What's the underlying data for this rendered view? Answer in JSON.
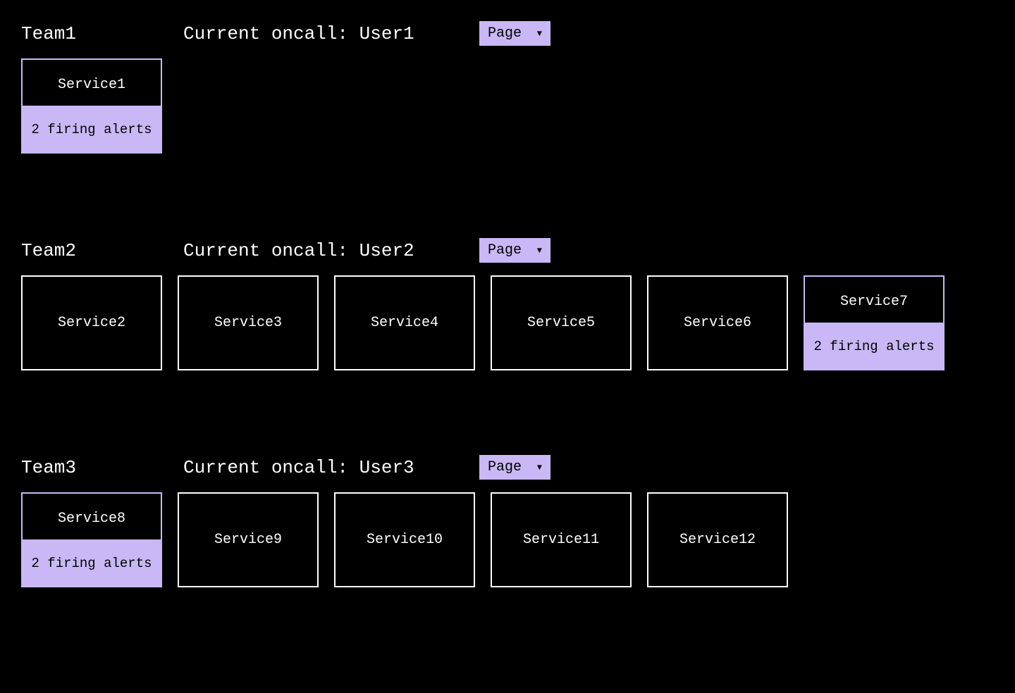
{
  "colors": {
    "accent": "#c9b8f5",
    "bg": "#000000",
    "fg": "#ffffff"
  },
  "oncall_prefix": "Current oncall: ",
  "page_action_label": "Page",
  "teams": [
    {
      "name": "Team1",
      "oncall_user": "User1",
      "services": [
        {
          "name": "Service1",
          "alert_text": "2 firing alerts"
        }
      ]
    },
    {
      "name": "Team2",
      "oncall_user": "User2",
      "services": [
        {
          "name": "Service2",
          "alert_text": null
        },
        {
          "name": "Service3",
          "alert_text": null
        },
        {
          "name": "Service4",
          "alert_text": null
        },
        {
          "name": "Service5",
          "alert_text": null
        },
        {
          "name": "Service6",
          "alert_text": null
        },
        {
          "name": "Service7",
          "alert_text": "2 firing alerts"
        }
      ]
    },
    {
      "name": "Team3",
      "oncall_user": "User3",
      "services": [
        {
          "name": "Service8",
          "alert_text": "2 firing alerts"
        },
        {
          "name": "Service9",
          "alert_text": null
        },
        {
          "name": "Service10",
          "alert_text": null
        },
        {
          "name": "Service11",
          "alert_text": null
        },
        {
          "name": "Service12",
          "alert_text": null
        }
      ]
    }
  ]
}
